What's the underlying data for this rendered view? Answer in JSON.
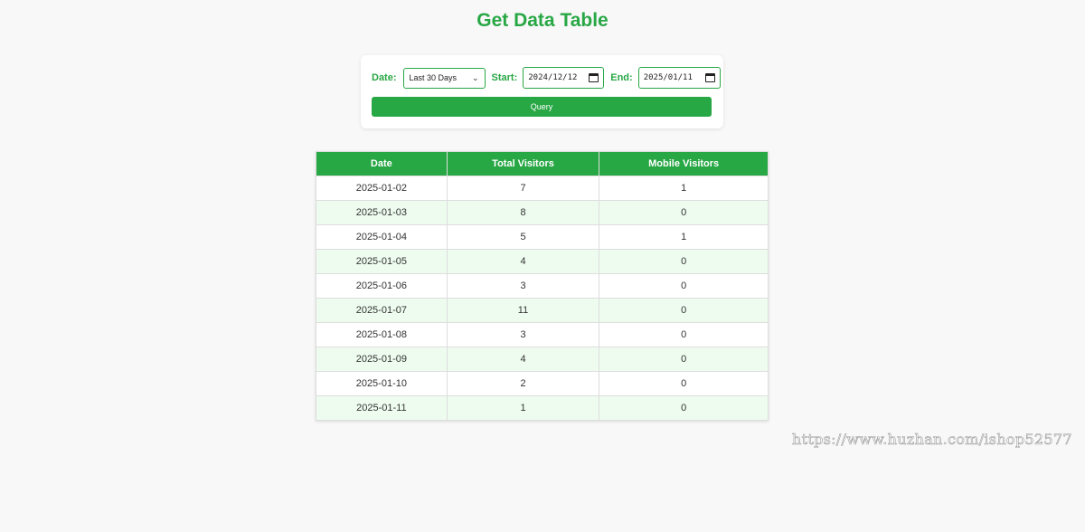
{
  "page": {
    "title": "Get Data Table"
  },
  "filters": {
    "date_label": "Date:",
    "date_range_value": "Last 30 Days",
    "start_label": "Start:",
    "start_value": "2024/12/12",
    "end_label": "End:",
    "end_value": "2025/01/11",
    "query_label": "Query"
  },
  "table": {
    "headers": [
      "Date",
      "Total Visitors",
      "Mobile Visitors"
    ],
    "rows": [
      [
        "2025-01-02",
        "7",
        "1"
      ],
      [
        "2025-01-03",
        "8",
        "0"
      ],
      [
        "2025-01-04",
        "5",
        "1"
      ],
      [
        "2025-01-05",
        "4",
        "0"
      ],
      [
        "2025-01-06",
        "3",
        "0"
      ],
      [
        "2025-01-07",
        "11",
        "0"
      ],
      [
        "2025-01-08",
        "3",
        "0"
      ],
      [
        "2025-01-09",
        "4",
        "0"
      ],
      [
        "2025-01-10",
        "2",
        "0"
      ],
      [
        "2025-01-11",
        "1",
        "0"
      ]
    ]
  },
  "watermark": "https://www.huzhan.com/ishop52577",
  "colors": {
    "accent": "#28a745",
    "row_alt": "#eefcef",
    "background": "#f8f8f8"
  }
}
